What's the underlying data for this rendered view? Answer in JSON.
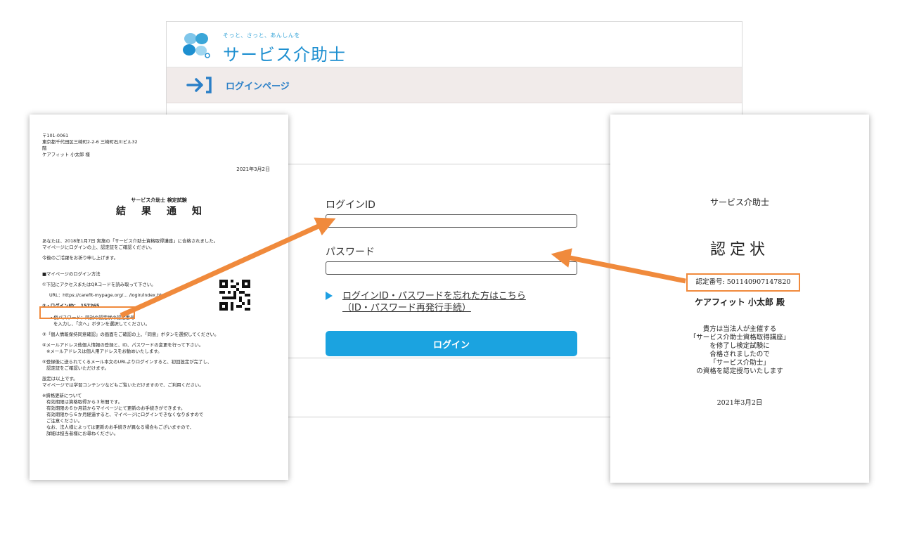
{
  "login_page": {
    "tagline": "そっと、さっと、あんしんを",
    "site_name": "サービス介助士",
    "page_title": "ログインページ",
    "login_id_label": "ログインID",
    "password_label": "パスワード",
    "forgot_link_line1": "ログインID・パスワードを忘れた方はこちら",
    "forgot_link_line2": "（ID・パスワード再発行手続）",
    "login_button": "ログイン",
    "colors": {
      "accent": "#1ba3e0",
      "brand": "#1d8fd0",
      "highlight": "#f08a3c"
    }
  },
  "notice_doc": {
    "address_lines": [
      "〒101-0061",
      "東京都千代田区三崎町2-2-6 三崎町石川ビル32",
      "階",
      "ケアフィット 小太郎 様"
    ],
    "date": "2021年3月2日",
    "subtitle": "サービス介助士 検定試験",
    "title": "結果通知",
    "para1": "あなたは、2018年1月7日 実施の「サービス介助士資格取得講座」に合格されました。",
    "para1b": "マイページにログインの上、認定証をご確認ください。",
    "para2": "今後のご活躍をお祈り申し上げます。",
    "howto_heading": "■マイページのログイン方法",
    "step1": "①下記にアクセスまたはQRコードを読み取って下さい。",
    "step1_url": "URL：https://carefit-mypage.org/… /login/index.html",
    "step2_id": "②・ログインID：　157265",
    "step2_pw1": "・仮パスワード：同封の認定状の認定番号",
    "step2_pw2": "を入力し、「次へ」ボタンを選択してください。",
    "step3": "③「個人情報保持同意確認」の画面をご確認の上、「同意」ボタンを選択してください。",
    "step4a": "④メールアドレス他個人情報の登録と、ID、パスワードの変更を行って下さい。",
    "step4b": "※メールアドレスは個人用アドレスをお勧めいたします。",
    "step5a": "⑤登録後に送られてくるメール本文のURLよりログインすると、初回設定が完了し、",
    "step5b": "認定証をご確認いただけます。",
    "done1": "設定は以上です。",
    "done2": "マイページでは学習コンテンツなどもご覧いただけますので、ご利用ください。",
    "renew_lines": [
      "※資格更新について",
      "有効期限は資格取得から３年間です。",
      "有効期限の６か月前からマイページにて更新のお手続きができます。",
      "有効期限から６か月経過すると、マイページにログインできなくなりますので",
      "ご注意ください。",
      "なお、法人様によっては更新のお手続きが異なる場合もございますので、",
      "詳細は担当者様にお尋ねください。"
    ]
  },
  "certificate": {
    "org": "サービス介助士",
    "title": "認定状",
    "number": "認定番号: 501140907147820",
    "recipient": "ケアフィット 小太郎 殿",
    "body_lines": [
      "貴方は当法人が主催する",
      "「サービス介助士資格取得講座」",
      "を修了し検定試験に",
      "合格されましたので",
      "「サービス介助士」",
      "の資格を認定授与いたします"
    ],
    "date": "2021年3月2日"
  }
}
